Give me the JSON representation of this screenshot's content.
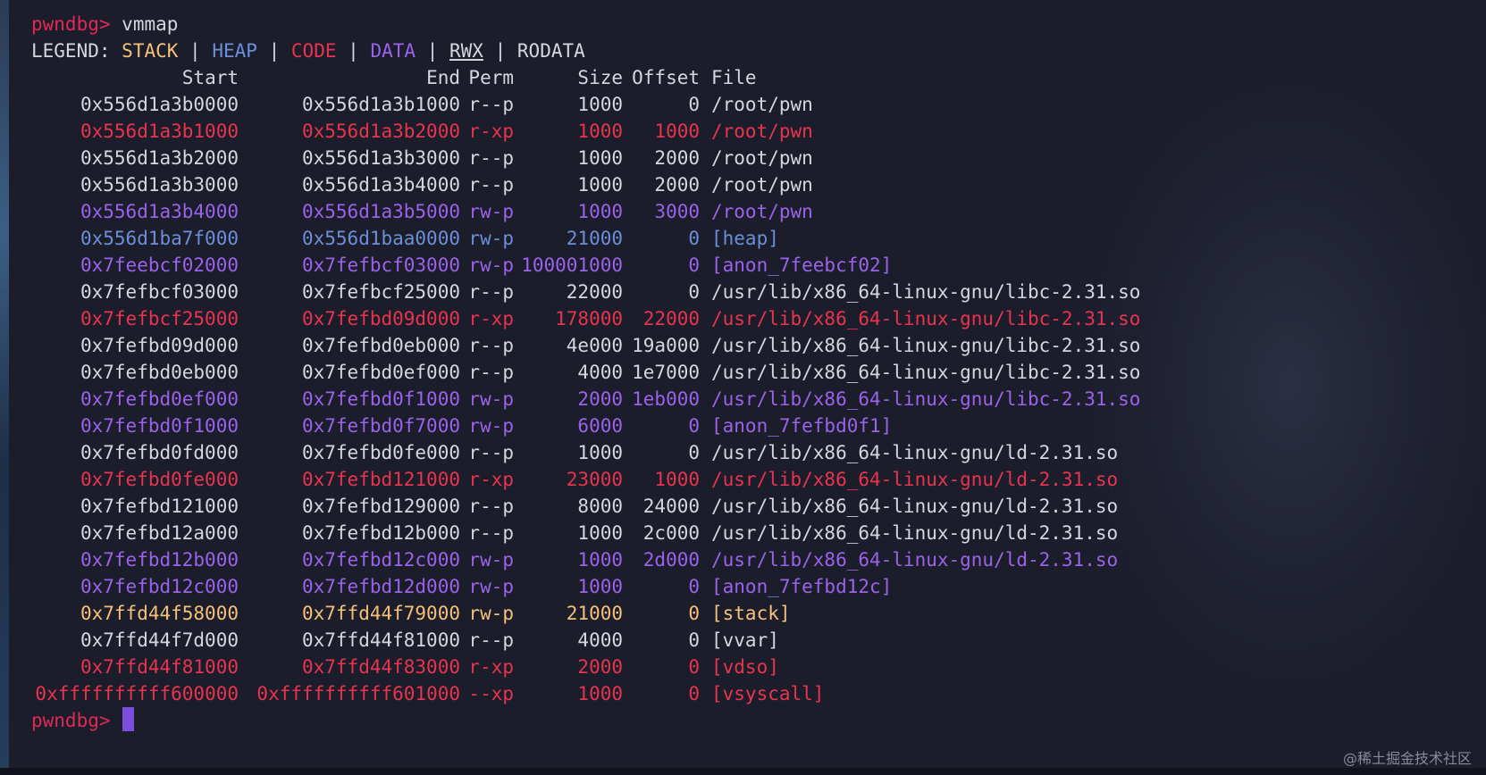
{
  "colors": {
    "default": "#d6d6df",
    "prompt": "#e02a55",
    "stack": "#f5c07a",
    "heap": "#6b8fd8",
    "code": "#e8344e",
    "data": "#9a63ea",
    "rwx": "#d6d6df",
    "rodata": "#d6d6df"
  },
  "prompt": "pwndbg>",
  "command": "vmmap",
  "legend": {
    "label": "LEGEND:",
    "sep": "|",
    "stack": "STACK",
    "heap": "HEAP",
    "code": "CODE",
    "data": "DATA",
    "rwx": "RWX",
    "rodata": "RODATA"
  },
  "header": {
    "start": "Start",
    "end": "End",
    "perm": "Perm",
    "size": "Size",
    "offset": "Offset",
    "file": "File"
  },
  "rows": [
    {
      "start": "0x556d1a3b0000",
      "end": "0x556d1a3b1000",
      "perm": "r--p",
      "size": "1000",
      "offset": "0",
      "file": "/root/pwn",
      "kind": "rodata"
    },
    {
      "start": "0x556d1a3b1000",
      "end": "0x556d1a3b2000",
      "perm": "r-xp",
      "size": "1000",
      "offset": "1000",
      "file": "/root/pwn",
      "kind": "code"
    },
    {
      "start": "0x556d1a3b2000",
      "end": "0x556d1a3b3000",
      "perm": "r--p",
      "size": "1000",
      "offset": "2000",
      "file": "/root/pwn",
      "kind": "rodata"
    },
    {
      "start": "0x556d1a3b3000",
      "end": "0x556d1a3b4000",
      "perm": "r--p",
      "size": "1000",
      "offset": "2000",
      "file": "/root/pwn",
      "kind": "rodata"
    },
    {
      "start": "0x556d1a3b4000",
      "end": "0x556d1a3b5000",
      "perm": "rw-p",
      "size": "1000",
      "offset": "3000",
      "file": "/root/pwn",
      "kind": "data"
    },
    {
      "start": "0x556d1ba7f000",
      "end": "0x556d1baa0000",
      "perm": "rw-p",
      "size": "21000",
      "offset": "0",
      "file": "[heap]",
      "kind": "heap"
    },
    {
      "start": "0x7feebcf02000",
      "end": "0x7fefbcf03000",
      "perm": "rw-p",
      "size": "100001000",
      "offset": "0",
      "file": "[anon_7feebcf02]",
      "kind": "data"
    },
    {
      "start": "0x7fefbcf03000",
      "end": "0x7fefbcf25000",
      "perm": "r--p",
      "size": "22000",
      "offset": "0",
      "file": "/usr/lib/x86_64-linux-gnu/libc-2.31.so",
      "kind": "rodata"
    },
    {
      "start": "0x7fefbcf25000",
      "end": "0x7fefbd09d000",
      "perm": "r-xp",
      "size": "178000",
      "offset": "22000",
      "file": "/usr/lib/x86_64-linux-gnu/libc-2.31.so",
      "kind": "code"
    },
    {
      "start": "0x7fefbd09d000",
      "end": "0x7fefbd0eb000",
      "perm": "r--p",
      "size": "4e000",
      "offset": "19a000",
      "file": "/usr/lib/x86_64-linux-gnu/libc-2.31.so",
      "kind": "rodata"
    },
    {
      "start": "0x7fefbd0eb000",
      "end": "0x7fefbd0ef000",
      "perm": "r--p",
      "size": "4000",
      "offset": "1e7000",
      "file": "/usr/lib/x86_64-linux-gnu/libc-2.31.so",
      "kind": "rodata"
    },
    {
      "start": "0x7fefbd0ef000",
      "end": "0x7fefbd0f1000",
      "perm": "rw-p",
      "size": "2000",
      "offset": "1eb000",
      "file": "/usr/lib/x86_64-linux-gnu/libc-2.31.so",
      "kind": "data"
    },
    {
      "start": "0x7fefbd0f1000",
      "end": "0x7fefbd0f7000",
      "perm": "rw-p",
      "size": "6000",
      "offset": "0",
      "file": "[anon_7fefbd0f1]",
      "kind": "data"
    },
    {
      "start": "0x7fefbd0fd000",
      "end": "0x7fefbd0fe000",
      "perm": "r--p",
      "size": "1000",
      "offset": "0",
      "file": "/usr/lib/x86_64-linux-gnu/ld-2.31.so",
      "kind": "rodata"
    },
    {
      "start": "0x7fefbd0fe000",
      "end": "0x7fefbd121000",
      "perm": "r-xp",
      "size": "23000",
      "offset": "1000",
      "file": "/usr/lib/x86_64-linux-gnu/ld-2.31.so",
      "kind": "code"
    },
    {
      "start": "0x7fefbd121000",
      "end": "0x7fefbd129000",
      "perm": "r--p",
      "size": "8000",
      "offset": "24000",
      "file": "/usr/lib/x86_64-linux-gnu/ld-2.31.so",
      "kind": "rodata"
    },
    {
      "start": "0x7fefbd12a000",
      "end": "0x7fefbd12b000",
      "perm": "r--p",
      "size": "1000",
      "offset": "2c000",
      "file": "/usr/lib/x86_64-linux-gnu/ld-2.31.so",
      "kind": "rodata"
    },
    {
      "start": "0x7fefbd12b000",
      "end": "0x7fefbd12c000",
      "perm": "rw-p",
      "size": "1000",
      "offset": "2d000",
      "file": "/usr/lib/x86_64-linux-gnu/ld-2.31.so",
      "kind": "data"
    },
    {
      "start": "0x7fefbd12c000",
      "end": "0x7fefbd12d000",
      "perm": "rw-p",
      "size": "1000",
      "offset": "0",
      "file": "[anon_7fefbd12c]",
      "kind": "data"
    },
    {
      "start": "0x7ffd44f58000",
      "end": "0x7ffd44f79000",
      "perm": "rw-p",
      "size": "21000",
      "offset": "0",
      "file": "[stack]",
      "kind": "stack"
    },
    {
      "start": "0x7ffd44f7d000",
      "end": "0x7ffd44f81000",
      "perm": "r--p",
      "size": "4000",
      "offset": "0",
      "file": "[vvar]",
      "kind": "rodata"
    },
    {
      "start": "0x7ffd44f81000",
      "end": "0x7ffd44f83000",
      "perm": "r-xp",
      "size": "2000",
      "offset": "0",
      "file": "[vdso]",
      "kind": "code"
    },
    {
      "start": "0xffffffffff600000",
      "end": "0xffffffffff601000",
      "perm": "--xp",
      "size": "1000",
      "offset": "0",
      "file": "[vsyscall]",
      "kind": "code"
    }
  ],
  "watermark": "@稀土掘金技术社区"
}
